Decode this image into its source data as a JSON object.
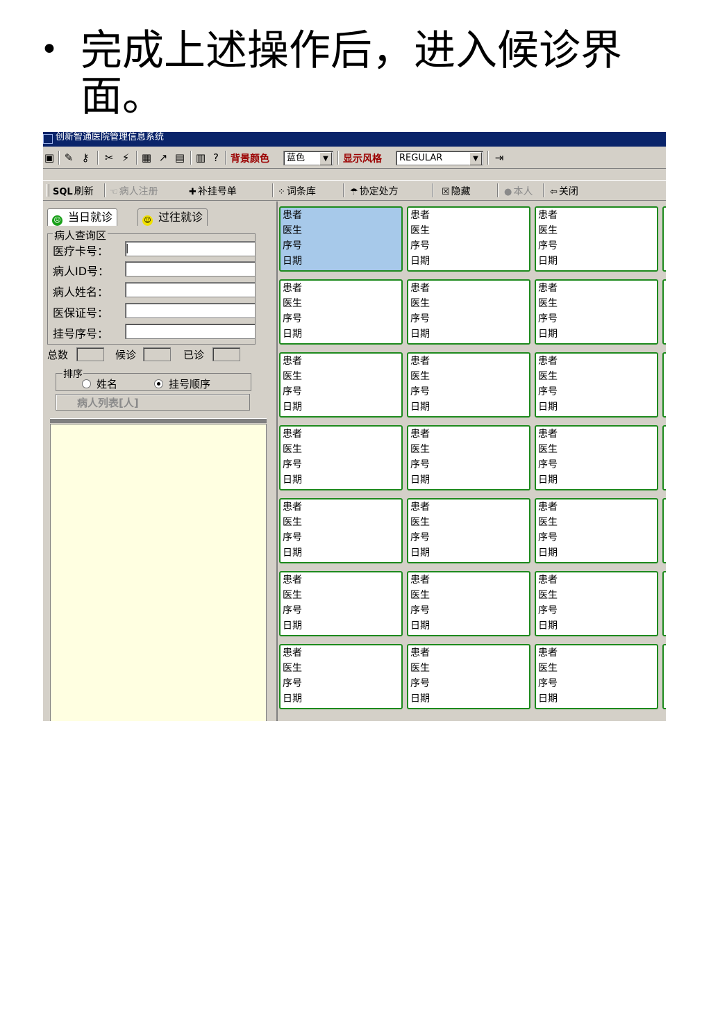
{
  "slide": {
    "bullet": "•",
    "heading": "完成上述操作后，进入候诊界面。"
  },
  "window": {
    "title": "创新智通医院管理信息系统"
  },
  "toolbar": {
    "bg_color_label": "背景颜色",
    "bg_color_value": "蓝色",
    "style_label": "显示风格",
    "style_value": "REGULAR"
  },
  "actions": {
    "refresh": "刷新",
    "register_patient": "病人注册",
    "supplement_ticket": "补挂号单",
    "vocabulary": "词条库",
    "agreed_prescription": "协定处方",
    "hide": "隐藏",
    "self": "本人",
    "close": "关闭",
    "sql_tag": "SQL"
  },
  "tabs": {
    "today": "当日就诊",
    "past": "过往就诊"
  },
  "query": {
    "group_title": "病人查询区",
    "fields": [
      {
        "label": "医疗卡号：",
        "value": "|"
      },
      {
        "label": "病人ID号：",
        "value": ""
      },
      {
        "label": "病人姓名：",
        "value": ""
      },
      {
        "label": "医保证号：",
        "value": ""
      },
      {
        "label": "挂号序号：",
        "value": ""
      }
    ],
    "counts": {
      "total_label": "总数",
      "waiting_label": "候诊",
      "done_label": "已诊"
    },
    "sort": {
      "title": "排序",
      "option_name": "姓名",
      "option_order": "挂号顺序",
      "selected": "挂号顺序"
    },
    "patient_list_label": "病人列表[人]"
  },
  "cards": {
    "patient_label": "患者",
    "doctor_label": "医生",
    "seq_label": "序号",
    "date_label": "日期"
  },
  "colors": {
    "card_border": "#1d8a1d",
    "card_selected": "#a7c9ea",
    "title_bar": "#0a246a",
    "list_area": "#ffffe1"
  }
}
